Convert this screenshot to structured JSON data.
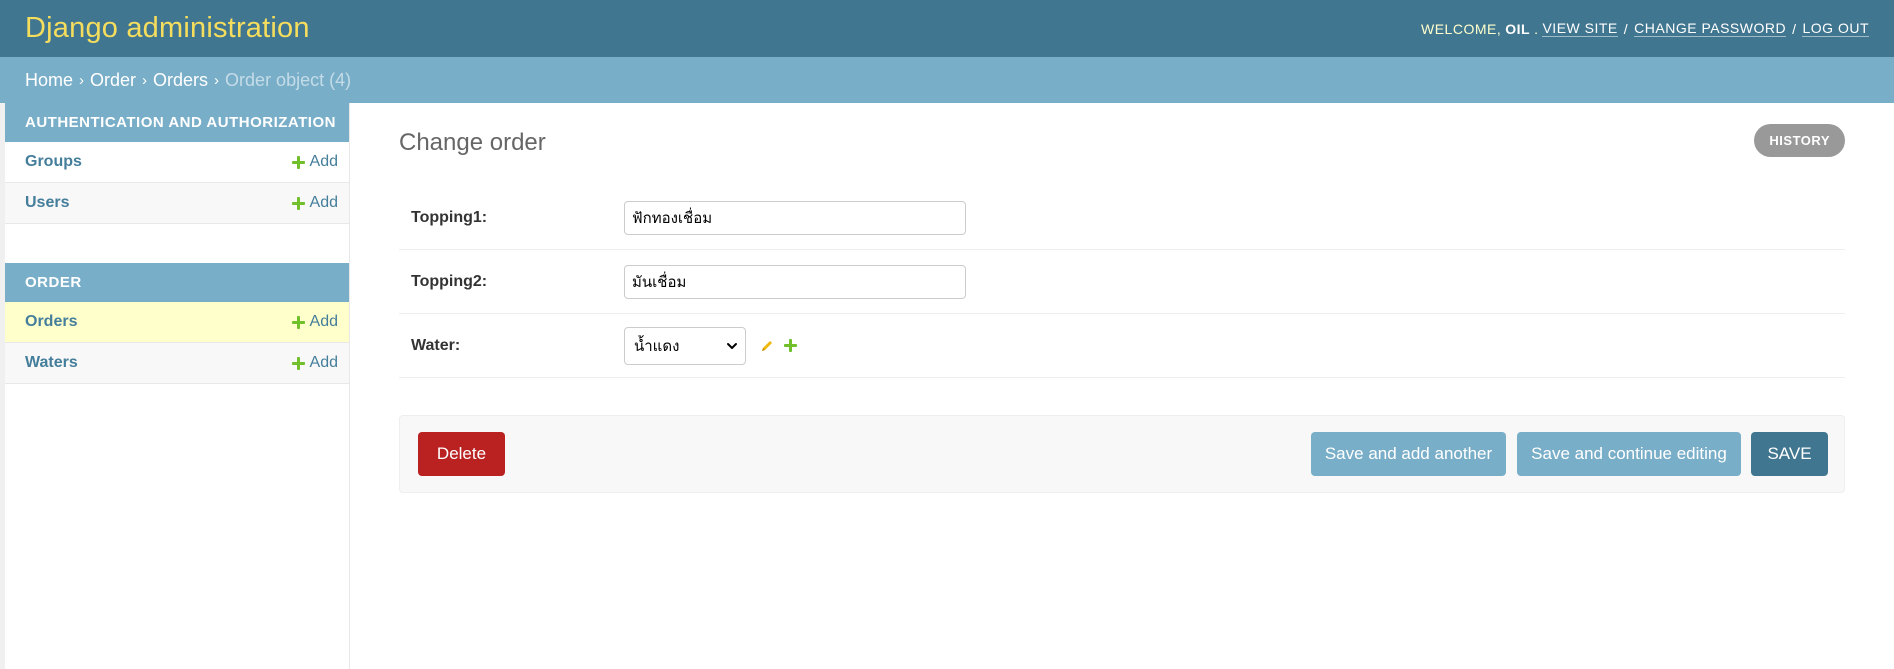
{
  "header": {
    "brand": "Django administration",
    "welcome": "WELCOME,",
    "username": "OIL",
    "view_site": "VIEW SITE",
    "change_password": "CHANGE PASSWORD",
    "log_out": "LOG OUT",
    "separator": "/"
  },
  "breadcrumbs": {
    "home": "Home",
    "app": "Order",
    "model": "Orders",
    "current": "Order object (4)",
    "chevron": "›"
  },
  "sidebar": {
    "modules": [
      {
        "caption": "Authentication and Authorization",
        "rows": [
          {
            "name": "Groups",
            "add": "Add"
          },
          {
            "name": "Users",
            "add": "Add"
          }
        ]
      },
      {
        "caption": "Order",
        "rows": [
          {
            "name": "Orders",
            "add": "Add"
          },
          {
            "name": "Waters",
            "add": "Add"
          }
        ]
      }
    ]
  },
  "content": {
    "title": "Change order",
    "history": "History",
    "fields": {
      "topping1": {
        "label": "Topping1:",
        "value": "ฟักทองเชื่อม"
      },
      "topping2": {
        "label": "Topping2:",
        "value": "มันเชื่อม"
      },
      "water": {
        "label": "Water:",
        "selected": "น้ำแดง"
      }
    }
  },
  "actions": {
    "delete": "Delete",
    "save_add": "Save and add another",
    "save_continue": "Save and continue editing",
    "save": "Save"
  },
  "colors": {
    "header_bg": "#417690",
    "brand": "#f5dd5d",
    "breadcrumb_bg": "#79aec8",
    "delete": "#ba2121",
    "add_plus": "#70bf2b",
    "selected_row": "#ffffcc"
  },
  "icons": {
    "add": "plus-icon",
    "edit": "pencil-icon",
    "select": "chevron-down-icon"
  }
}
